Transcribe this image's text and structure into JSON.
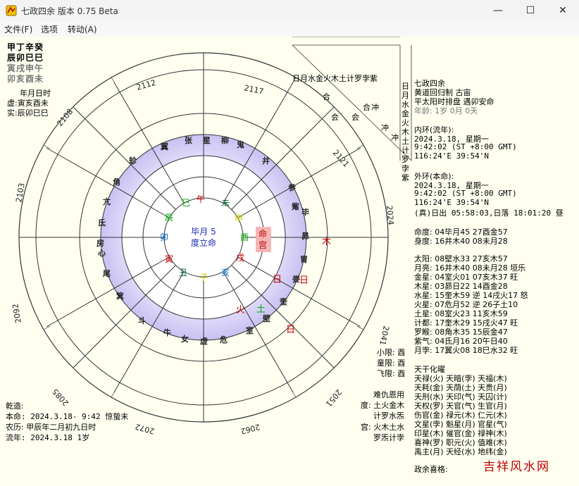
{
  "window": {
    "title": "七政四余 版本 0.75 Beta",
    "buttons": {
      "minimize": "—",
      "maximize": "☐",
      "close": "✕"
    }
  },
  "menu": {
    "items": [
      "文件(F)",
      "选项",
      "转动(A)"
    ]
  },
  "left_top": {
    "rows": [
      "甲丁辛癸",
      "辰卯巳巳",
      "寅戌申午",
      "卯亥酉未"
    ],
    "labels": [
      "年月日时",
      "虚:寅亥酉未",
      "实:辰卯巳巳"
    ]
  },
  "center": {
    "title": "毕月 5",
    "subtitle": "度立命"
  },
  "top_table": {
    "header": [
      "日",
      "月",
      "水",
      "金",
      "火",
      "木",
      "土",
      "计",
      "罗",
      "孛",
      "紫"
    ],
    "side": [
      "日",
      "月",
      "水",
      "金",
      "火",
      "木",
      "土",
      "计",
      "罗",
      "孛",
      "紫"
    ],
    "marks": [
      {
        "r": 0,
        "c": 4,
        "t": "合"
      },
      {
        "r": 0,
        "c": 7,
        "t": "合"
      },
      {
        "r": 1,
        "c": 7,
        "t": "冲"
      },
      {
        "r": 2,
        "c": 2,
        "t": "会"
      },
      {
        "r": 2,
        "c": 4,
        "t": "会"
      },
      {
        "r": 2,
        "c": 6,
        "t": "冲"
      },
      {
        "r": 3,
        "c": 9,
        "t": "冲"
      }
    ]
  },
  "right_info": {
    "head": [
      "七政四余",
      "黄道回归制  古宙",
      "平太阳时排盘  遇卯安命",
      "年龄: 1岁 0月 0天"
    ],
    "inner": [
      "内环(流年):",
      "2024.3.18, 星期一",
      "  9:42:02 (ST +8:00 GMT)",
      "116:24'E  39:54'N"
    ],
    "outer": [
      "外环(本命):",
      "2024.3.18, 星期一",
      "  9:42:02 (ST +8:00 GMT)",
      "116:24'E  39:54'N",
      "(真)日出 05:58:03,日落 18:01:20 昼"
    ],
    "positions": [
      "命度: 04毕月45    27酉金57",
      "身度: 16井木40    08未月28",
      "太阳: 08壁水33    27亥木57",
      "月亮: 16井木40    08未月28 垣乐",
      "金星: 04室火01    07亥木37 旺",
      "木星: 03昴日22    14酉金28",
      "水星: 15奎木59 逆  14戌火17 怒",
      "火星: 07危月52 逆  26子土10",
      "土星: 08室火23    11亥木59",
      "计都: 17奎木29    15戌火47 旺",
      "罗睺: 08角木35    15辰金47",
      "紫气: 04氐月16    20午日40",
      "月孛: 17翼火08    18巳水32 旺"
    ],
    "gods_title": "天干化曜",
    "gods": [
      "天禄(火) 天暗(孛) 天福(木)",
      "天耗(金) 天荫(土) 天贵(月)",
      "天刑(水) 天印(气) 天囚(计)",
      "天权(罗) 天官(气) 生官(月)",
      "伤官(金) 禄元(木) 仁元(木)",
      "文星(孛) 魁星(月) 官星(气)",
      "印星(木) 催官(金) 禄神(木)",
      "喜神(罗) 职元(火) 值难(木)",
      "禹主(月) 天经(水) 地纬(金)"
    ],
    "footer": "政余喜格:"
  },
  "lower_left": {
    "labels": [
      "乾造:",
      "本命: 2024.3.18- 9:42 惊蛰末",
      "农历: 甲辰年二月初九日时",
      "流年: 2024.3.18 1岁"
    ]
  },
  "bottom_mid": {
    "labels": [
      "小限: 酉",
      "童限: 酉",
      "飞限: 酉",
      "难仇恩用",
      "度: 土火金木",
      "计罗水炁",
      "宫: 火木土水",
      "罗炁计孛"
    ]
  },
  "watermark": "吉祥风水网"
}
